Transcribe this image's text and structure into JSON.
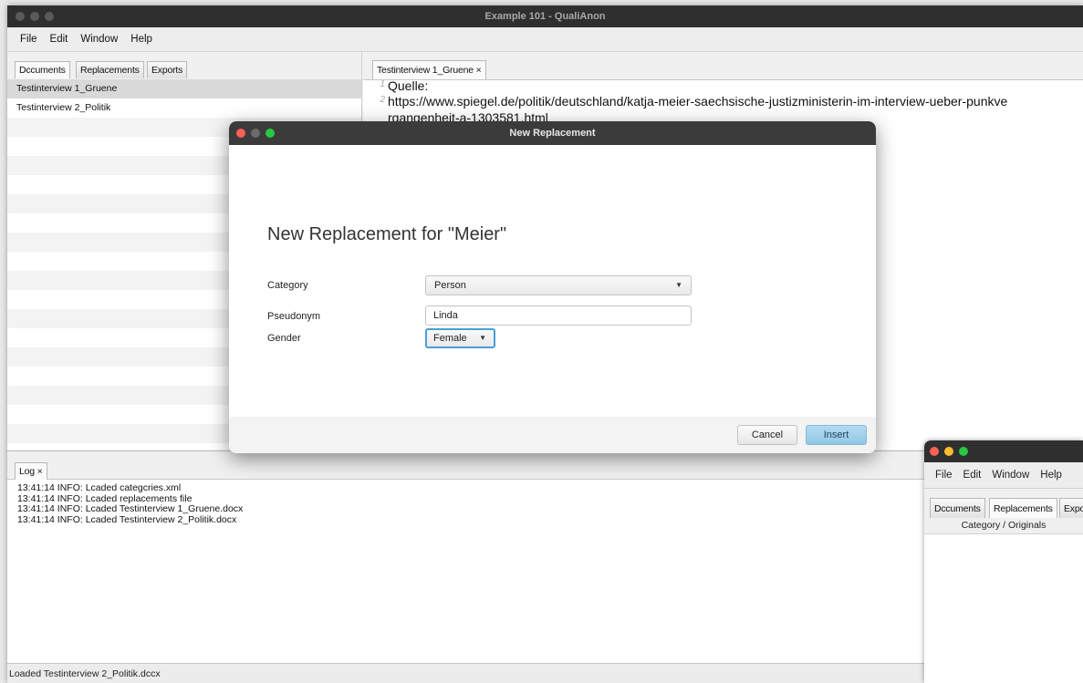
{
  "main_window": {
    "title": "Example 101 - QualiAnon",
    "menu": [
      "File",
      "Edit",
      "Window",
      "Help"
    ],
    "left_tabs": [
      "Dccuments",
      "Replacements",
      "Exports"
    ],
    "documents": [
      "Testinterview 1_Gruene",
      "Testinterview 2_Politik"
    ],
    "editor_tab": "Testinterview 1_Gruene ×",
    "editor_lines": [
      {
        "num": "1",
        "text": "Quelle:"
      },
      {
        "num": "2",
        "text": "https://www.spiegel.de/politik/deutschland/katja-meier-saechsische-justizministerin-im-interview-ueber-punkve"
      },
      {
        "num": "",
        "text": "rgangenheit-a-1303581.html"
      }
    ],
    "log_tab": "Log ×",
    "log_lines": [
      "13:41:14 INFO: Lcaded categcries.xml",
      "13:41:14 INFO: Lcaded replacements file",
      "13:41:14 INFO: Lcaded Testinterview 1_Gruene.docx",
      "13:41:14 INFO: Lcaded Testinterview 2_Politik.docx"
    ],
    "status": "Loaded Testinterview 2_Politik.dccx"
  },
  "dialog": {
    "title": "New Replacement",
    "heading": "New Replacement for \"Meier\"",
    "category_label": "Category",
    "category_value": "Person",
    "pseudonym_label": "Pseudonym",
    "pseudonym_value": "Linda",
    "gender_label": "Gender",
    "gender_value": "Female",
    "cancel_label": "Cancel",
    "insert_label": "Insert"
  },
  "second_window": {
    "menu": [
      "File",
      "Edit",
      "Window",
      "Help"
    ],
    "tabs": [
      "Dccuments",
      "Replacements",
      "Expo"
    ],
    "column_header": "Category / Originals"
  },
  "colors": {
    "accent": "#9ccce9",
    "focus_ring": "#4a9fd8",
    "close": "#fe5f57",
    "minimize": "#febc2e",
    "zoom": "#28c840",
    "selected_row": "#d9d9d9"
  }
}
